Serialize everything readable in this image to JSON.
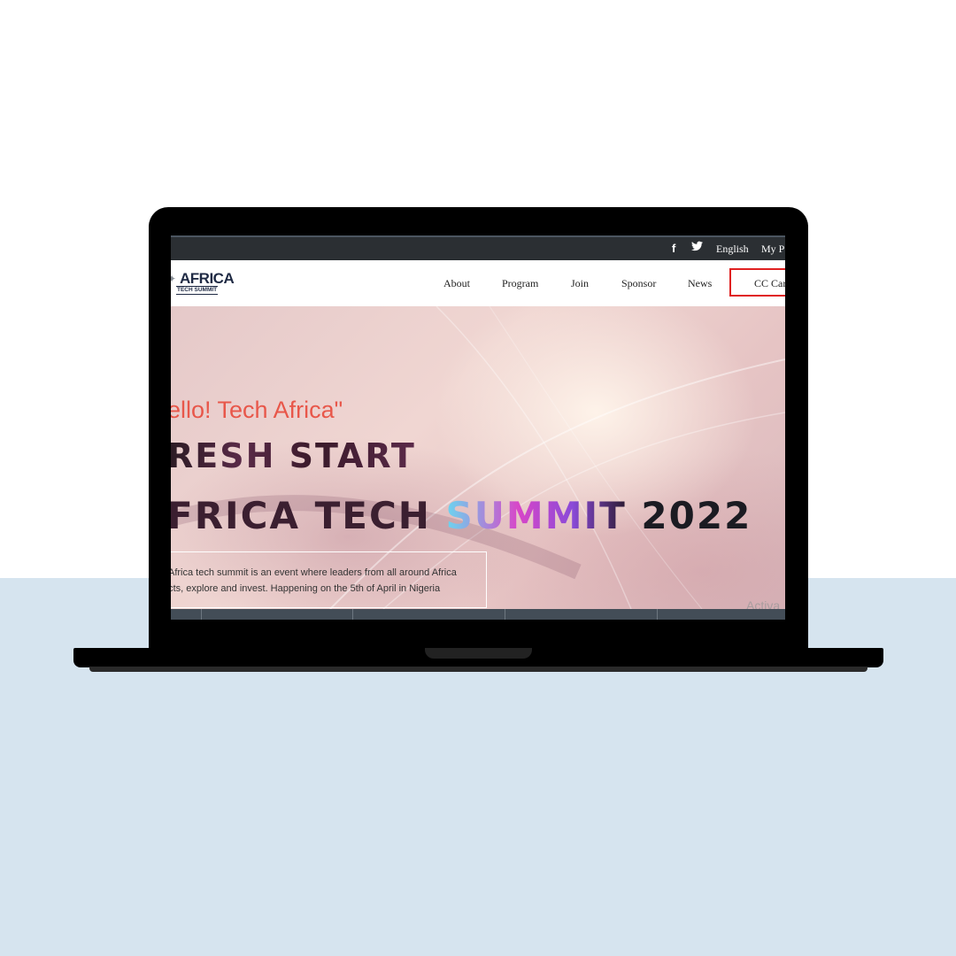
{
  "topbar": {
    "facebook_icon": "f",
    "twitter_icon": "twitter-bird",
    "language": "English",
    "profile": "My P"
  },
  "logo": {
    "main": "AFRICA",
    "sub": "TECH SUMMIT"
  },
  "nav": {
    "items": [
      "About",
      "Program",
      "Join",
      "Sponsor",
      "News"
    ],
    "cta_label": "CC Car"
  },
  "hero": {
    "greeting": "ello! Tech Africa\"",
    "headline_1": "RESH START",
    "headline_2_a": "FRICA TECH ",
    "headline_2_b": "SUMMIT",
    "headline_2_c": " 2022",
    "description_line_1": "Africa tech summit is an event where leaders from all around Africa",
    "description_line_2": "ects, explore and invest. Happening on the 5th of April in Nigeria",
    "watermark": "Activa"
  },
  "colors": {
    "accent_red": "#e8574a",
    "cta_border": "#e02020",
    "topbar_bg": "#2b2f33",
    "page_bottom_bg": "#d6e4ef"
  }
}
